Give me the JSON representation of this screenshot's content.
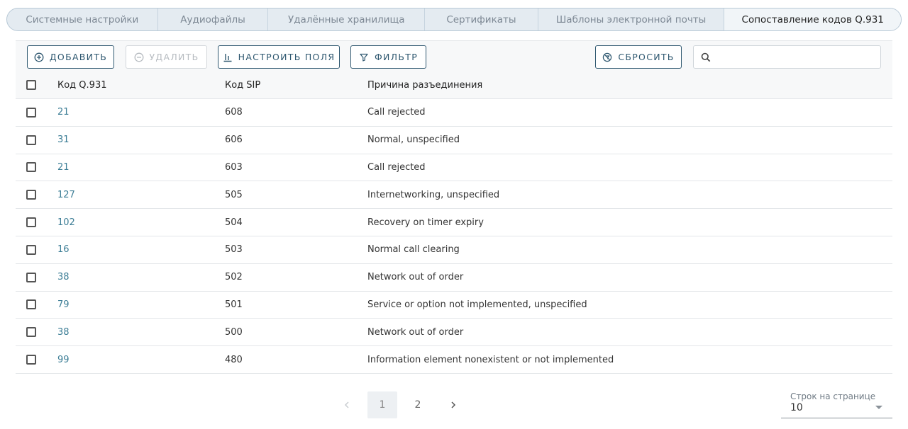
{
  "tabs": [
    {
      "label": "Системные настройки"
    },
    {
      "label": "Аудиофайлы"
    },
    {
      "label": "Удалённые хранилища"
    },
    {
      "label": "Сертификаты"
    },
    {
      "label": "Шаблоны электронной почты"
    },
    {
      "label": "Сопоставление кодов Q.931"
    }
  ],
  "active_tab": 5,
  "toolbar": {
    "add_label": "ДОБАВИТЬ",
    "delete_label": "УДАЛИТЬ",
    "configure_label": "НАСТРОИТЬ ПОЛЯ",
    "filter_label": "ФИЛЬТР",
    "reset_label": "СБРОСИТЬ",
    "search_placeholder": ""
  },
  "table": {
    "columns": [
      "Код Q.931",
      "Код SIP",
      "Причина разъединения"
    ],
    "rows": [
      {
        "q931": "21",
        "sip": "608",
        "reason": "Call rejected"
      },
      {
        "q931": "31",
        "sip": "606",
        "reason": "Normal, unspecified"
      },
      {
        "q931": "21",
        "sip": "603",
        "reason": "Call rejected"
      },
      {
        "q931": "127",
        "sip": "505",
        "reason": "Internetworking, unspecified"
      },
      {
        "q931": "102",
        "sip": "504",
        "reason": "Recovery on timer expiry"
      },
      {
        "q931": "16",
        "sip": "503",
        "reason": "Normal call clearing"
      },
      {
        "q931": "38",
        "sip": "502",
        "reason": "Network out of order"
      },
      {
        "q931": "79",
        "sip": "501",
        "reason": "Service or option not implemented, unspecified"
      },
      {
        "q931": "38",
        "sip": "500",
        "reason": "Network out of order"
      },
      {
        "q931": "99",
        "sip": "480",
        "reason": "Information element nonexistent or not implemented"
      }
    ]
  },
  "pagination": {
    "pages": [
      "1",
      "2"
    ],
    "current": "1",
    "rows_per_page_label": "Строк на странице",
    "rows_per_page_value": "10"
  },
  "colors": {
    "accent": "#2f5870",
    "link": "#3d7e96"
  }
}
